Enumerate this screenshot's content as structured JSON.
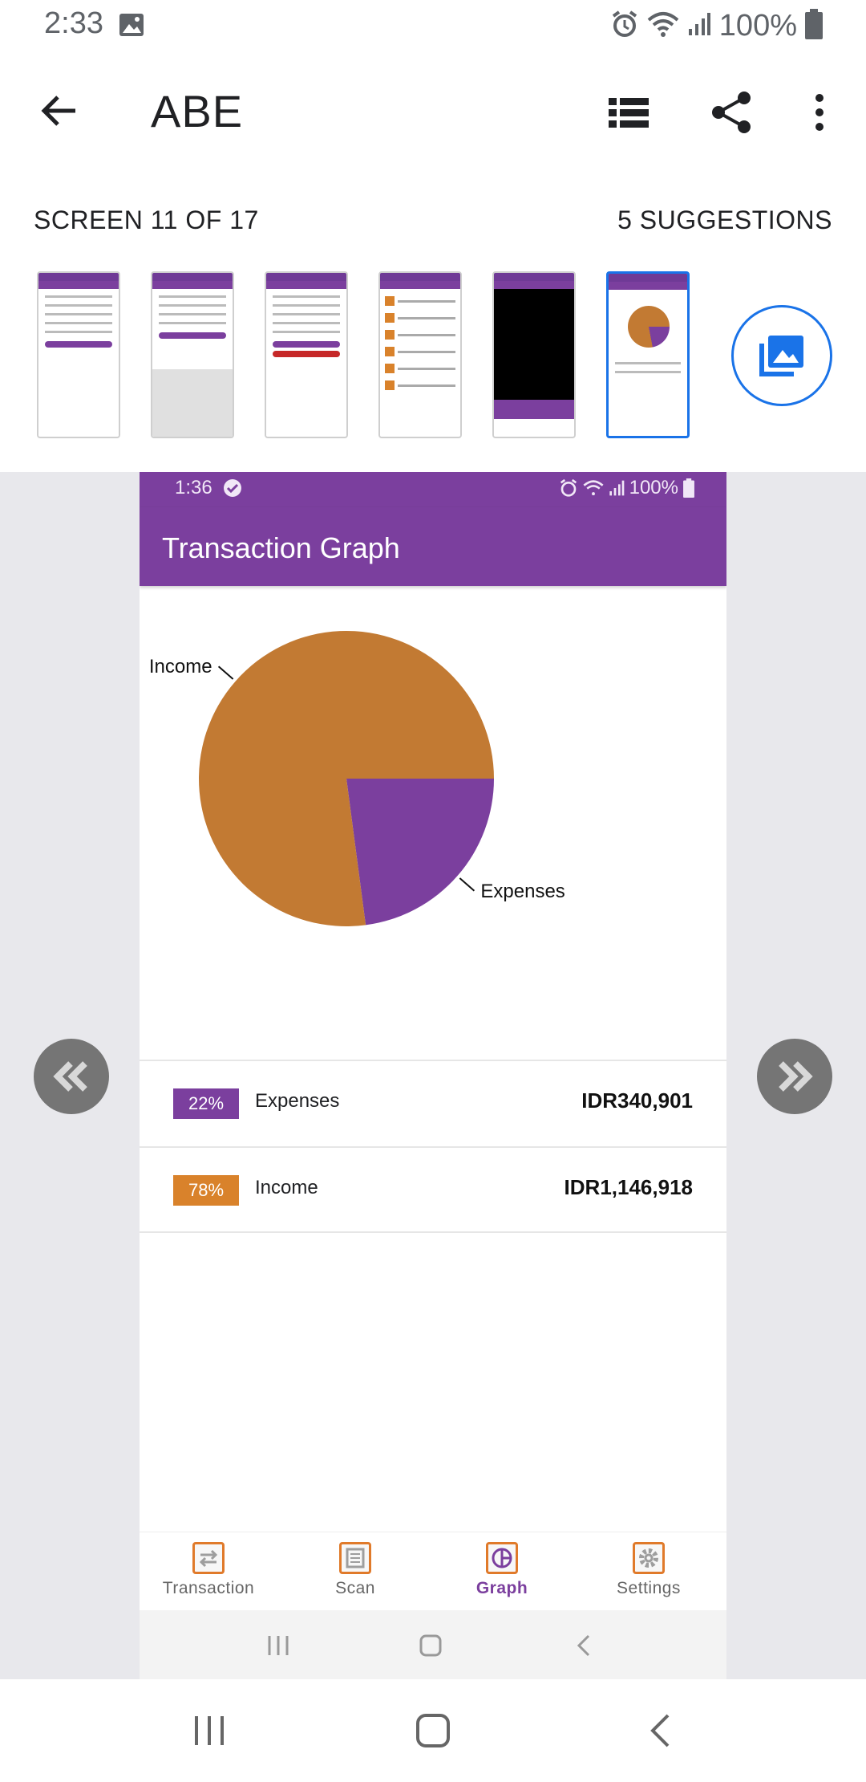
{
  "status_bar": {
    "time": "2:33",
    "battery": "100%"
  },
  "app_bar": {
    "title": "ABE"
  },
  "counter": {
    "screen": "SCREEN 11 OF 17",
    "suggestions": "5 SUGGESTIONS"
  },
  "phone": {
    "status": {
      "time": "1:36",
      "battery": "100%"
    },
    "title": "Transaction Graph",
    "legend": [
      {
        "percent": "22%",
        "name": "Expenses",
        "amount": "IDR340,901",
        "color": "#7b3f9e"
      },
      {
        "percent": "78%",
        "name": "Income",
        "amount": "IDR1,146,918",
        "color": "#d9822b"
      }
    ],
    "bottom_nav": [
      {
        "label": "Transaction"
      },
      {
        "label": "Scan"
      },
      {
        "label": "Graph"
      },
      {
        "label": "Settings"
      }
    ]
  },
  "colors": {
    "accent": "#7b3f9e",
    "income": "#c27a33",
    "expenses": "#7b3f9e",
    "selection": "#1a73e8"
  },
  "chart_data": {
    "type": "pie",
    "categories": [
      "Expenses",
      "Income"
    ],
    "values": [
      340901,
      1146918
    ],
    "percentages": [
      22,
      78
    ],
    "colors": [
      "#7b3f9e",
      "#c27a33"
    ],
    "title": ""
  }
}
